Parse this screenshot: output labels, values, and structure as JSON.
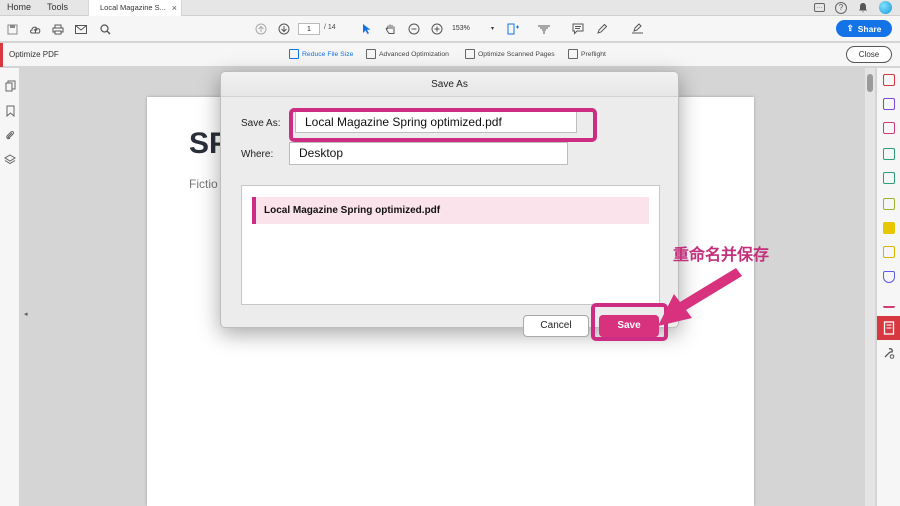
{
  "tabs": {
    "home": "Home",
    "tools": "Tools",
    "document": "Local Magazine S...",
    "close": "×"
  },
  "toolbar": {
    "page_current": "1",
    "page_total": "/ 14",
    "zoom": "153%",
    "share_label": "Share"
  },
  "optimize_bar": {
    "title": "Optimize PDF",
    "items": [
      "Reduce File Size",
      "Advanced Optimization",
      "Optimize Scanned Pages",
      "Preflight"
    ],
    "close_label": "Close"
  },
  "document": {
    "heading": "SP",
    "subheading": "Fictio"
  },
  "dialog": {
    "title": "Save As",
    "save_as_label": "Save As:",
    "save_as_value": "Local Magazine Spring optimized.pdf",
    "where_label": "Where:",
    "where_value": "Desktop",
    "file_item": "Local Magazine Spring optimized.pdf",
    "cancel_label": "Cancel",
    "save_label": "Save"
  },
  "annotation": {
    "text": "重命名并保存"
  },
  "colors": {
    "accent_pink": "#cc2d82",
    "save_button": "#d8317d",
    "share_blue": "#1473e6",
    "tool_red": "#d7373f"
  }
}
